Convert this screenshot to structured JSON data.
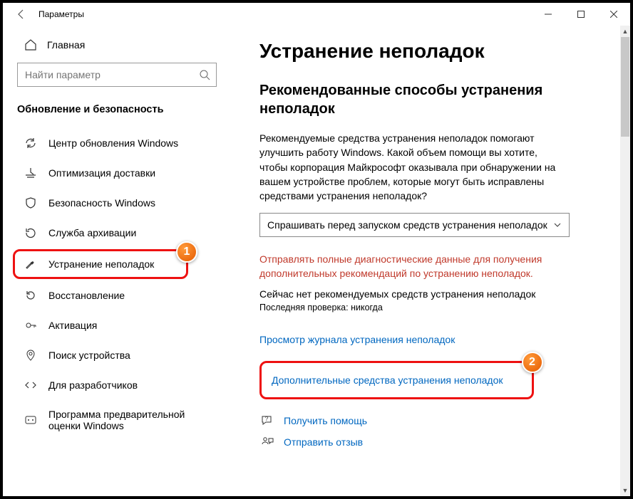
{
  "window": {
    "title": "Параметры"
  },
  "sidebar": {
    "home": "Главная",
    "search_placeholder": "Найти параметр",
    "section": "Обновление и безопасность",
    "items": [
      {
        "label": "Центр обновления Windows"
      },
      {
        "label": "Оптимизация доставки"
      },
      {
        "label": "Безопасность Windows"
      },
      {
        "label": "Служба архивации"
      },
      {
        "label": "Устранение неполадок"
      },
      {
        "label": "Восстановление"
      },
      {
        "label": "Активация"
      },
      {
        "label": "Поиск устройства"
      },
      {
        "label": "Для разработчиков"
      },
      {
        "label": "Программа предварительной оценки Windows"
      }
    ]
  },
  "main": {
    "heading": "Устранение неполадок",
    "subheading": "Рекомендованные способы устранения неполадок",
    "description": "Рекомендуемые средства устранения неполадок помогают улучшить работу Windows. Какой объем помощи вы хотите, чтобы корпорация Майкрософт оказывала при обнаружении на вашем устройстве проблем, которые могут быть исправлены средствами устранения неполадок?",
    "dropdown_value": "Спрашивать перед запуском средств устранения неполадок",
    "warning": "Отправлять полные диагностические данные для получения дополнительных рекомендаций по устранению неполадок.",
    "status": "Сейчас нет рекомендуемых средств устранения неполадок",
    "last_check": "Последняя проверка: никогда",
    "link_history": "Просмотр журнала устранения неполадок",
    "link_additional": "Дополнительные средства устранения неполадок",
    "help": "Получить помощь",
    "feedback": "Отправить отзыв"
  },
  "annotations": {
    "b1": "1",
    "b2": "2"
  }
}
